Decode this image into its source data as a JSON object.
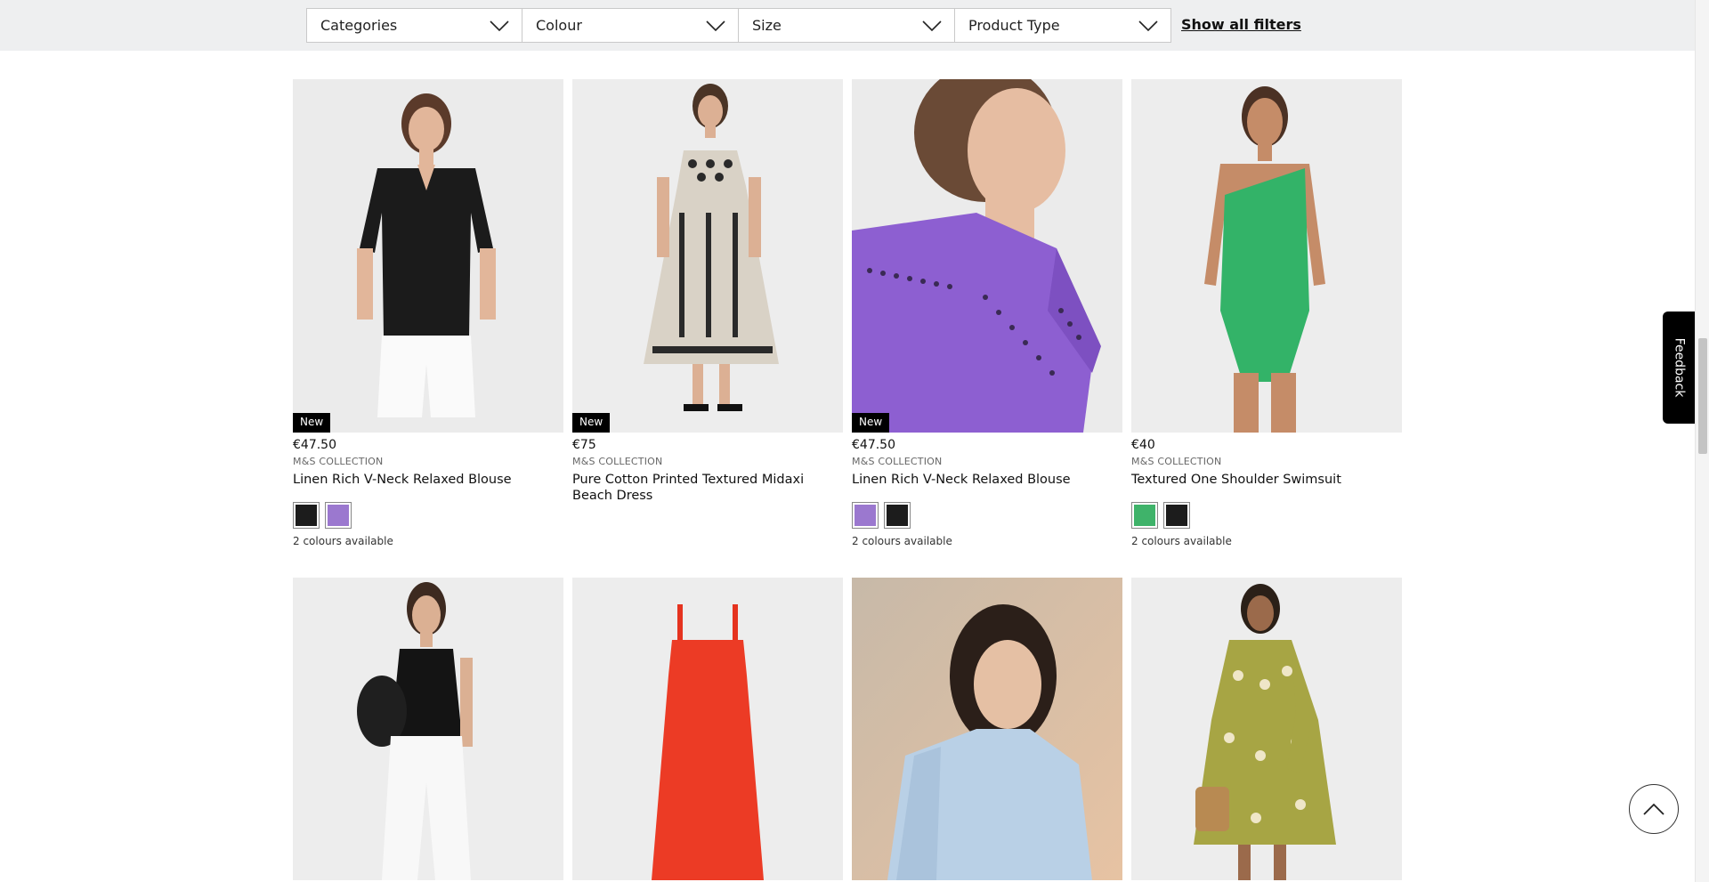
{
  "filters": {
    "items": [
      {
        "label": "Categories"
      },
      {
        "label": "Colour"
      },
      {
        "label": "Size"
      },
      {
        "label": "Product Type"
      }
    ],
    "show_all_label": "Show all filters"
  },
  "products_row1": [
    {
      "badge": "New",
      "price": "€47.50",
      "brand": "M&S COLLECTION",
      "title": "Linen Rich V-Neck Relaxed Blouse",
      "swatches": [
        "#1c1c1c",
        "#9b78cf"
      ],
      "availability": "2 colours available",
      "image": "black-blouse-model"
    },
    {
      "badge": "New",
      "price": "€75",
      "brand": "M&S COLLECTION",
      "title": "Pure Cotton Printed Textured Midaxi Beach Dress",
      "swatches": [],
      "availability": "",
      "image": "printed-midaxi-dress-model"
    },
    {
      "badge": "New",
      "price": "€47.50",
      "brand": "M&S COLLECTION",
      "title": "Linen Rich V-Neck Relaxed Blouse",
      "swatches": [
        "#9b78cf",
        "#1c1c1c"
      ],
      "availability": "2 colours available",
      "image": "purple-blouse-detail"
    },
    {
      "badge": "",
      "price": "€40",
      "brand": "M&S COLLECTION",
      "title": "Textured One Shoulder Swimsuit",
      "swatches": [
        "#3fb36a",
        "#1c1c1c"
      ],
      "availability": "2 colours available",
      "image": "green-swimsuit-model"
    }
  ],
  "products_row2": [
    {
      "image": "black-top-white-trousers-model"
    },
    {
      "image": "red-slip-dress"
    },
    {
      "image": "blue-blouse-model"
    },
    {
      "image": "green-print-mini-dress-model"
    }
  ],
  "feedback_label": "Feedback",
  "colors": {
    "filter_bar_bg": "#eeeff0",
    "badge_bg": "#000000"
  },
  "icons": {
    "filter_chevron": "chevron-down-icon",
    "back_to_top": "chevron-up-icon"
  }
}
